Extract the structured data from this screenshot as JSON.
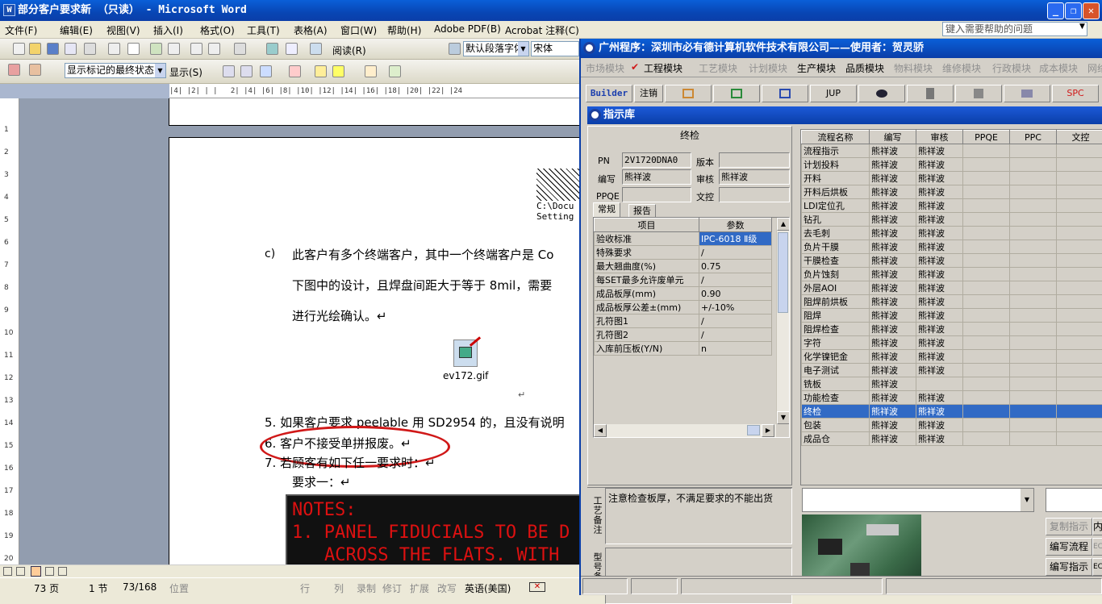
{
  "word": {
    "title": "部分客户要求新 （只读） - Microsoft Word",
    "app_icon": "W",
    "help_placeholder": "键入需要帮助的问题",
    "menu": [
      "文件(F)",
      "编辑(E)",
      "视图(V)",
      "插入(I)",
      "格式(O)",
      "工具(T)",
      "表格(A)",
      "窗口(W)",
      "帮助(H)",
      "Adobe PDF(B)",
      "Acrobat 注释(C)"
    ],
    "toolbar": {
      "read_label": "阅读(R)",
      "style_value": "默认段落字体",
      "font_value": "宋体"
    },
    "review_toolbar": {
      "markup_value": "显示标记的最终状态",
      "show_label": "显示(S)"
    },
    "ruler_text": "|4| |2| | |   2| |4| |6| |8| |10| |12| |14| |16| |18| |20| |22| |24",
    "vruler_marks": [
      "1",
      "2",
      "3",
      "4",
      "5",
      "6",
      "7",
      "8",
      "9",
      "10",
      "11",
      "12",
      "13",
      "14",
      "15",
      "16",
      "17",
      "18",
      "19",
      "20"
    ],
    "doc": {
      "img_path_1": "C:\\Docu",
      "img_path_2": "Setting",
      "c_marker": "c)",
      "c_line1": "此客户有多个终端客户，其中一个终端客户是 Co",
      "c_line2": "下图中的设计，且焊盘间距大于等于 8mil，需要",
      "c_line3": "进行光绘确认。↵",
      "gif_name": "ev172.gif",
      "para_mark": "↵",
      "item5": "5.  如果客户要求 peelable 用 SD2954 的，且没有说明",
      "item6": "6.  客户不接受单拼报废。↵",
      "item7": "7.  若顾客有如下任一要求时：↵",
      "req1": "要求一：↵",
      "notes_1": "NOTES:",
      "notes_2": "1. PANEL FIDUCIALS TO BE D",
      "notes_3": "ACROSS THE FLATS. WITH"
    },
    "status": {
      "page": "73 页",
      "section": "1 节",
      "pagecount": "73/168",
      "pos": "位置",
      "line": "行",
      "col": "列",
      "rec": "录制",
      "trk": "修订",
      "ext": "扩展",
      "ovr": "改写",
      "lang": "英语(美国)"
    }
  },
  "erp": {
    "title": "广州程序：深圳市必有德计算机软件技术有限公司——使用者：贺灵骄",
    "modules": [
      {
        "label": "市场模块",
        "active": false
      },
      {
        "label": "工程模块",
        "active": true
      },
      {
        "label": "工艺模块",
        "active": false
      },
      {
        "label": "计划模块",
        "active": false
      },
      {
        "label": "生产模块",
        "active": true
      },
      {
        "label": "品质模块",
        "active": true
      },
      {
        "label": "物料模块",
        "active": false
      },
      {
        "label": "维修模块",
        "active": false
      },
      {
        "label": "行政模块",
        "active": false
      },
      {
        "label": "成本模块",
        "active": false
      },
      {
        "label": "网络",
        "active": false
      }
    ],
    "tools": {
      "builder": "Builder",
      "logout": "注销",
      "jup": "JUP",
      "spc": "SPC"
    },
    "subtitle": "指示库",
    "form": {
      "header": "终检",
      "pn_label": "PN",
      "pn_value": "2V1720DNA0",
      "version_label": "版本",
      "version_value": "",
      "writer_label": "编写",
      "writer_value": "熊祥波",
      "audit_label": "审核",
      "audit_value": "熊祥波",
      "ppqe_label": "PPQE",
      "ppqe_value": "",
      "proof_label": "文控",
      "proof_value": "",
      "tab_general": "常规",
      "tab_report": "报告"
    },
    "param_headers": [
      "项目",
      "参数"
    ],
    "params": [
      [
        "验收标准",
        "IPC-6018 Ⅱ级"
      ],
      [
        "特殊要求",
        "/"
      ],
      [
        "最大翘曲度(%)",
        "0.75"
      ],
      [
        "每SET最多允许废单元",
        "/"
      ],
      [
        "成品板厚(mm)",
        "0.90"
      ],
      [
        "成品板厚公差±(mm)",
        "+/-10%"
      ],
      [
        "孔符图1",
        "/"
      ],
      [
        "孔符图2",
        "/"
      ],
      [
        "入库前压板(Y/N)",
        "n"
      ]
    ],
    "process_headers": [
      "流程名称",
      "编写",
      "审核",
      "PPQE",
      "PPC",
      "文控"
    ],
    "processes": [
      [
        "流程指示",
        "熊祥波",
        "熊祥波"
      ],
      [
        "计划投料",
        "熊祥波",
        "熊祥波"
      ],
      [
        "开料",
        "熊祥波",
        "熊祥波"
      ],
      [
        "开料后烘板",
        "熊祥波",
        "熊祥波"
      ],
      [
        "LDI定位孔",
        "熊祥波",
        "熊祥波"
      ],
      [
        "钻孔",
        "熊祥波",
        "熊祥波"
      ],
      [
        "去毛刺",
        "熊祥波",
        "熊祥波"
      ],
      [
        "负片干膜",
        "熊祥波",
        "熊祥波"
      ],
      [
        "干膜检查",
        "熊祥波",
        "熊祥波"
      ],
      [
        "负片蚀刻",
        "熊祥波",
        "熊祥波"
      ],
      [
        "外层AOI",
        "熊祥波",
        "熊祥波"
      ],
      [
        "阻焊前烘板",
        "熊祥波",
        "熊祥波"
      ],
      [
        "阻焊",
        "熊祥波",
        "熊祥波"
      ],
      [
        "阻焊检查",
        "熊祥波",
        "熊祥波"
      ],
      [
        "字符",
        "熊祥波",
        "熊祥波"
      ],
      [
        "化学镍钯金",
        "熊祥波",
        "熊祥波"
      ],
      [
        "电子测试",
        "熊祥波",
        "熊祥波"
      ],
      [
        "铣板",
        "熊祥波",
        ""
      ],
      [
        "功能检查",
        "熊祥波",
        "熊祥波"
      ],
      [
        "终检",
        "熊祥波",
        "熊祥波"
      ],
      [
        "包装",
        "熊祥波",
        "熊祥波"
      ],
      [
        "成品仓",
        "熊祥波",
        "熊祥波"
      ]
    ],
    "selected_process": "终检",
    "craft_note_label": "工艺备注",
    "craft_note": "注意检查板厚，不满足要求的不能出货",
    "type_note_label": "型号备注",
    "btn_copy": "复制指示",
    "btn_edit_flow": "编写流程",
    "btn_edit_instr": "编写指示",
    "btn_in": "内",
    "btn_ec1": "EC",
    "btn_ec2": "EC"
  }
}
